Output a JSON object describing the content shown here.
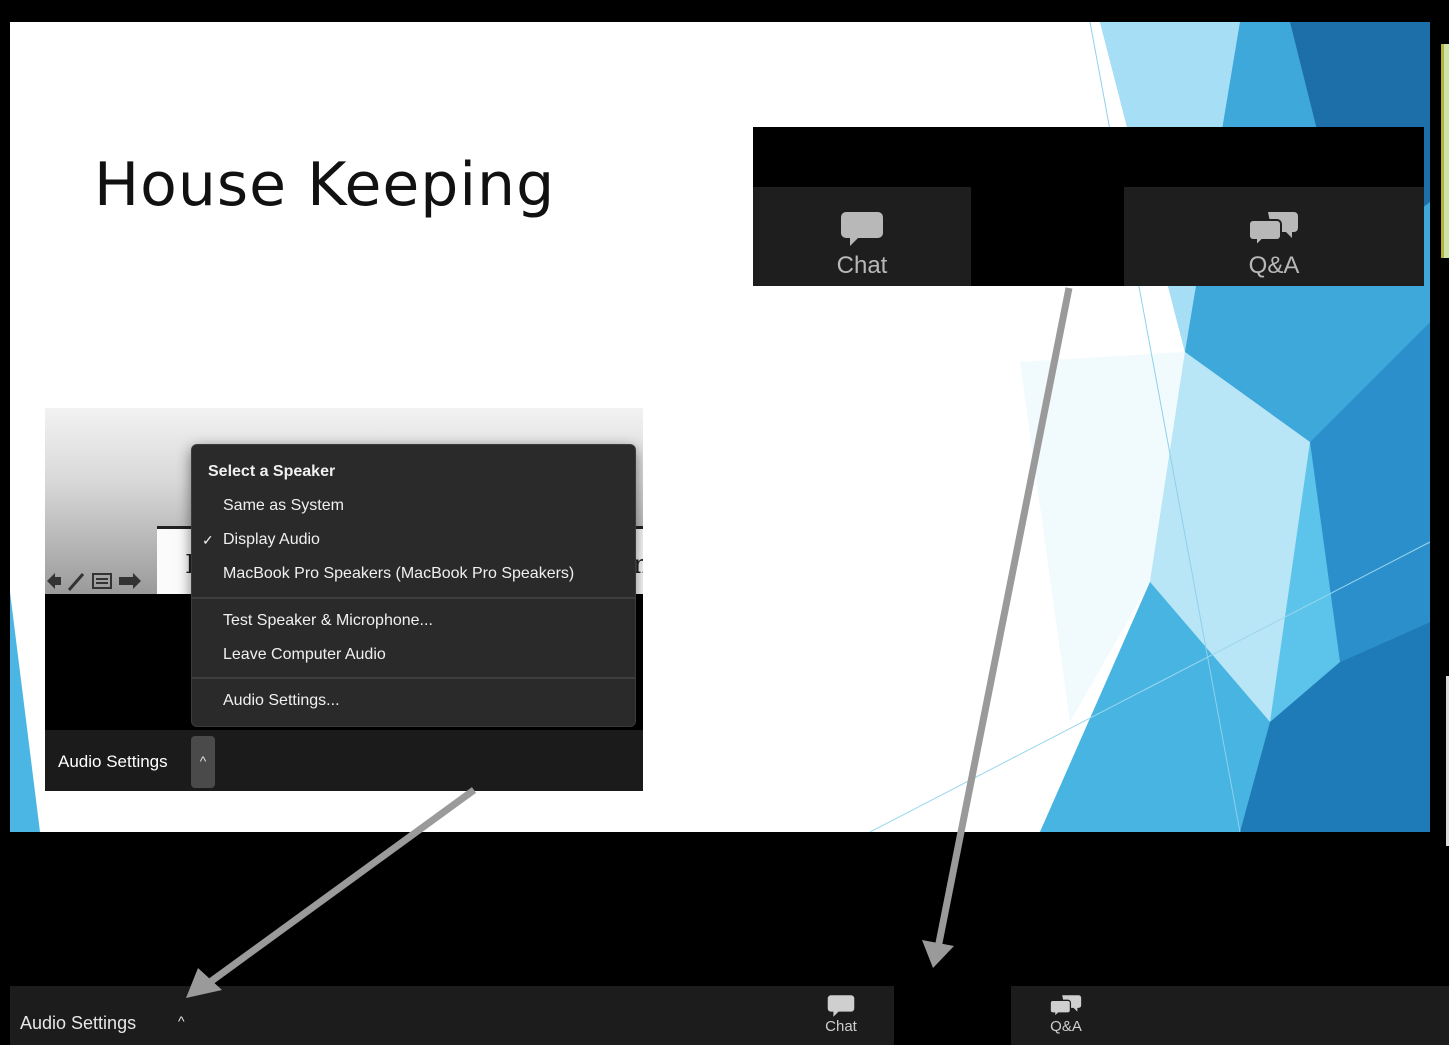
{
  "slide": {
    "title": "House Keeping"
  },
  "callout_top": {
    "chat_label": "Chat",
    "qa_label": "Q&A"
  },
  "audio_callout": {
    "menu": {
      "header": "Select a Speaker",
      "items": [
        {
          "label": "Same as System",
          "checked": false
        },
        {
          "label": "Display Audio",
          "checked": true
        },
        {
          "label": "MacBook Pro Speakers (MacBook Pro Speakers)",
          "checked": false
        }
      ],
      "actions": [
        {
          "label": "Test Speaker & Microphone..."
        },
        {
          "label": "Leave Computer Audio"
        }
      ],
      "settings": {
        "label": "Audio Settings..."
      },
      "check_glyph": "✓"
    },
    "toolbar": {
      "audio_label": "Audio Settings",
      "caret": "^"
    },
    "doc_glyph_left": "I",
    "doc_glyph_right": "n"
  },
  "bottom_toolbar": {
    "audio_label": "Audio Settings",
    "caret": "^",
    "chat_label": "Chat",
    "qa_label": "Q&A"
  },
  "colors": {
    "toolbar_bg": "#1c1c1c",
    "menu_bg": "#2a2a2a",
    "slide_accent_light": "#7fd3f0",
    "slide_accent_dark": "#1a6ea8",
    "arrow": "#9a9a9a"
  },
  "icons": {
    "chat": "chat-bubble-icon",
    "qa": "qa-bubbles-icon",
    "caret": "caret-up-icon",
    "check": "checkmark-icon"
  }
}
